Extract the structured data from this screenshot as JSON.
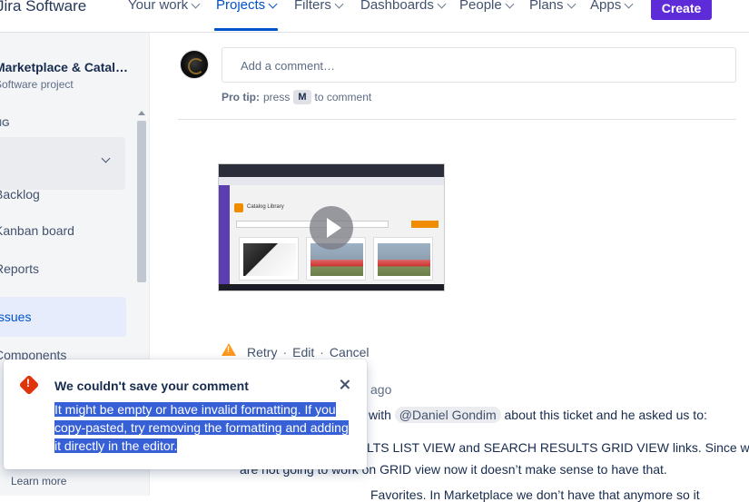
{
  "nav": {
    "logo": "Jira Software",
    "items": [
      "Your work",
      "Projects",
      "Filters",
      "Dashboards",
      "People",
      "Plans",
      "Apps"
    ],
    "active_index": 1,
    "create_label": "Create"
  },
  "sidebar": {
    "project_name": "Marketplace & Catal…",
    "project_type": "Software project",
    "section_label": "NG",
    "items": [
      "Backlog",
      "Kanban board",
      "Reports",
      "Issues",
      "Components"
    ],
    "active_item": "Issues",
    "partial_letters": [
      "P",
      "e",
      "c"
    ]
  },
  "comment": {
    "placeholder": "Add a comment…",
    "protip_label": "Pro tip:",
    "protip_press": "press",
    "protip_key": "M",
    "protip_suffix": "to comment"
  },
  "video": {
    "thumbnail_title": "Catalog Library"
  },
  "failed_comment": {
    "retry": "Retry",
    "edit": "Edit",
    "cancel": "Cancel",
    "separator": "·"
  },
  "activity": {
    "ago_fragment": "ago",
    "line1_prefix": "with",
    "mention": "@Daniel Gondim",
    "line1_suffix": "about this ticket and he asked us to:",
    "line2": "LTS LIST VIEW and SEARCH RESULTS GRID VIEW links. Since we",
    "line3": "are not going to work on GRID view now it doesn’t make sense to have that.",
    "line4": "Favorites. In Marketplace we don’t have that anymore so it"
  },
  "flag": {
    "title": "We couldn't save your comment",
    "body": "It might be empty or have invalid formatting. If you copy-pasted, try removing the formatting and adding it directly in the editor.",
    "learn_more": "Learn more"
  },
  "colors": {
    "brand_blue": "#0052cc",
    "create_purple": "#5e2bd8",
    "error_red": "#de350b",
    "warning_orange": "#ff991f",
    "selection_blue": "#3760d6"
  }
}
